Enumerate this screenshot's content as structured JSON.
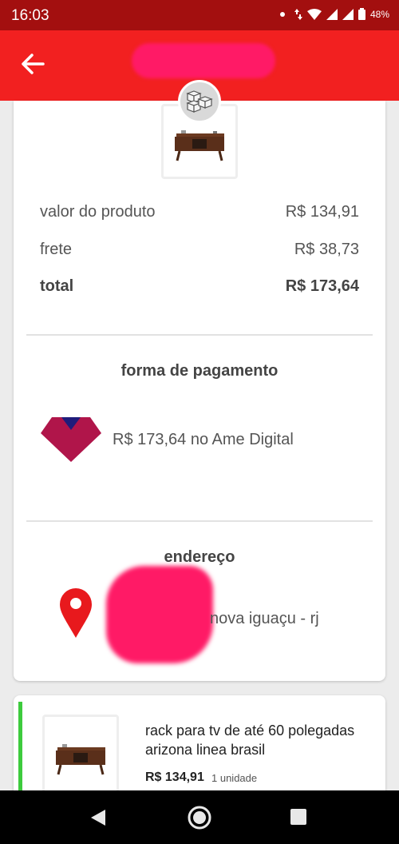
{
  "status_bar": {
    "time": "16:03",
    "battery": "48%"
  },
  "app_bar": {
    "back_icon": "arrow-left-icon",
    "title": ""
  },
  "summary": {
    "product_value_label": "valor do produto",
    "product_value": "R$ 134,91",
    "shipping_label": "frete",
    "shipping_value": "R$ 38,73",
    "total_label": "total",
    "total_value": "R$ 173,64"
  },
  "payment": {
    "title": "forma de pagamento",
    "text": "R$ 173,64 no Ame Digital",
    "logo_icon": "ame-digital-icon"
  },
  "address": {
    "title": "endereço",
    "city": "nova iguaçu - rj",
    "icon": "location-pin-icon"
  },
  "item": {
    "name": "rack para tv de até 60 polegadas arizona linea brasil",
    "price": "R$ 134,91",
    "quantity": "1 unidade"
  },
  "colors": {
    "status_bar": "#a30f0f",
    "app_bar": "#f22020",
    "accent_green": "#3dcb3d",
    "pin_red": "#e8191d",
    "ame_magenta": "#b0154a",
    "ame_navy": "#1f1c7a"
  }
}
